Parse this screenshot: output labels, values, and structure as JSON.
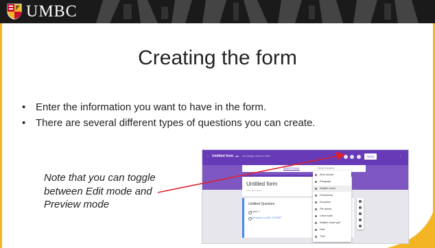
{
  "header": {
    "logo_text": "UMBC",
    "colors": {
      "banner": "#1a1a1a",
      "gold": "#f3b523",
      "red": "#c8102e"
    }
  },
  "slide": {
    "title": "Creating the form",
    "bullets": [
      "Enter the information you want to have in the form.",
      "There are several different types of questions you can create."
    ],
    "note": "Note that you can toggle between Edit mode and Preview mode",
    "arrow_color": "#e0202a"
  },
  "screenshot": {
    "app_title": "Untitled form",
    "saved_text": "All changes saved in Drive",
    "send_label": "SEND",
    "tabs": [
      "QUESTIONS",
      "RESPONSES"
    ],
    "form_title": "Untitled form",
    "form_description": "Form description",
    "question_title": "Untitled Question",
    "options": [
      "Option 1",
      "Add option or ADD \"OTHER\""
    ],
    "menu_items": [
      "Short answer",
      "Paragraph",
      "Multiple choice",
      "Checkboxes",
      "Dropdown",
      "File upload",
      "Linear scale",
      "Multiple choice grid",
      "Date",
      "Time"
    ],
    "selected_menu_item": "Multiple choice",
    "colors": {
      "primary": "#673ab7",
      "secondary": "#7e57c2",
      "accent": "#4285f4"
    }
  }
}
